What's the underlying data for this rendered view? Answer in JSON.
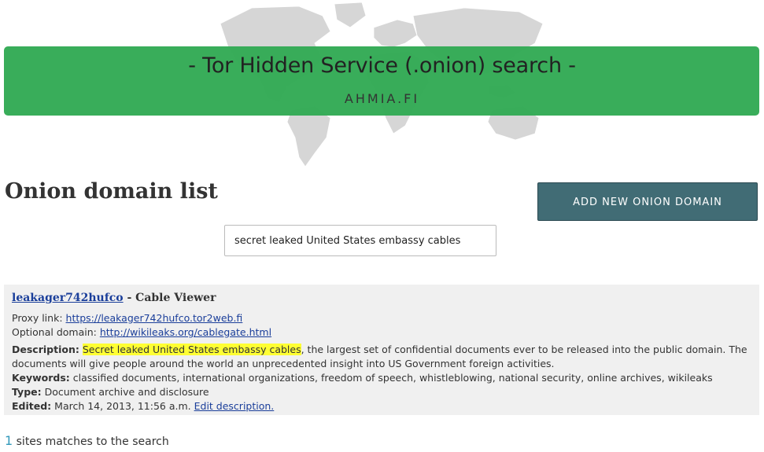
{
  "header": {
    "title": "- Tor Hidden Service (.onion) search -",
    "subtitle": "AHMIA.FI"
  },
  "page": {
    "title": "Onion domain list",
    "add_button": "ADD NEW ONION DOMAIN"
  },
  "search": {
    "value": "secret leaked United States embassy cables"
  },
  "result": {
    "domain": "leakager742hufco",
    "separator": " - ",
    "site_title": "Cable Viewer",
    "proxy_label": "Proxy link: ",
    "proxy_url": "https://leakager742hufco.tor2web.fi",
    "optional_label": "Optional domain: ",
    "optional_url": "http://wikileaks.org/cablegate.html",
    "description_label": "Description:",
    "description_highlight": "Secret leaked United States embassy cables",
    "description_rest_1": ", the largest set of confidential documents ever to be released into the public domain. The",
    "description_rest_2": "documents will give people around the world an unprecedented insight into US Government foreign activities.",
    "keywords_label": "Keywords:",
    "keywords": "classified documents, international organizations, freedom of speech, whistleblowing, national security, online archives, wikileaks",
    "type_label": "Type:",
    "type": "Document archive and disclosure",
    "edited_label": "Edited:",
    "edited": "March 14, 2013, 11:56 a.m.",
    "edit_link": "Edit description."
  },
  "footer": {
    "count": "1",
    "count_text": " sites matches to the search"
  },
  "colors": {
    "banner": "#33aa55",
    "button": "#416c75",
    "link": "#1a3e9a",
    "highlight": "#ffff33",
    "edit_link": "#228822",
    "count": "#3399bb"
  },
  "icons": [
    "world-map"
  ]
}
